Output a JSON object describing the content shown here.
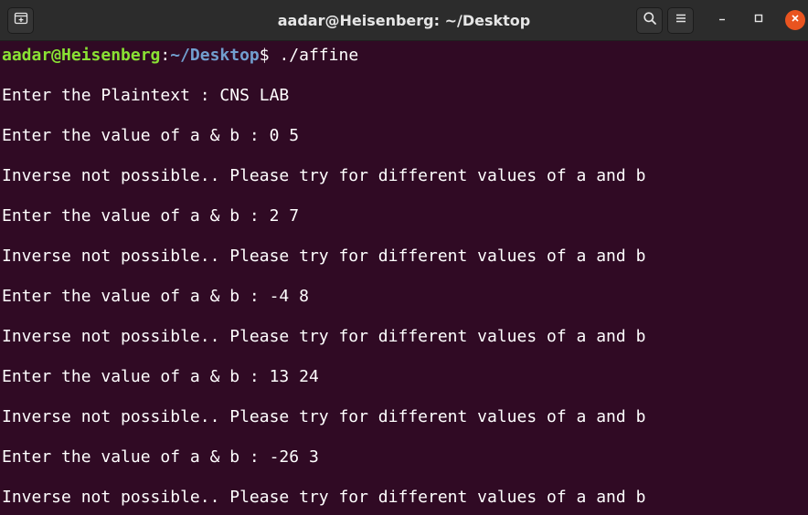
{
  "window": {
    "title": "aadar@Heisenberg: ~/Desktop"
  },
  "icons": {
    "new_tab": "new-tab-icon",
    "search": "search-icon",
    "menu": "hamburger-menu-icon",
    "minimize": "minimize-icon",
    "maximize": "maximize-icon",
    "close": "close-icon"
  },
  "colors": {
    "terminal_bg": "#300a24",
    "titlebar_bg": "#2c2c2c",
    "prompt_user": "#8ae234",
    "prompt_path": "#729fcf",
    "close_button": "#e95420"
  },
  "prompt": {
    "user_host": "aadar@Heisenberg",
    "separator": ":",
    "path": "~/Desktop",
    "symbol": "$",
    "command": " ./affine"
  },
  "output_lines": [
    "Enter the Plaintext : CNS LAB",
    "Enter the value of a & b : 0 5",
    "Inverse not possible.. Please try for different values of a and b",
    "Enter the value of a & b : 2 7",
    "Inverse not possible.. Please try for different values of a and b",
    "Enter the value of a & b : -4 8",
    "Inverse not possible.. Please try for different values of a and b",
    "Enter the value of a & b : 13 24",
    "Inverse not possible.. Please try for different values of a and b",
    "Enter the value of a & b : -26 3",
    "Inverse not possible.. Please try for different values of a and b"
  ]
}
